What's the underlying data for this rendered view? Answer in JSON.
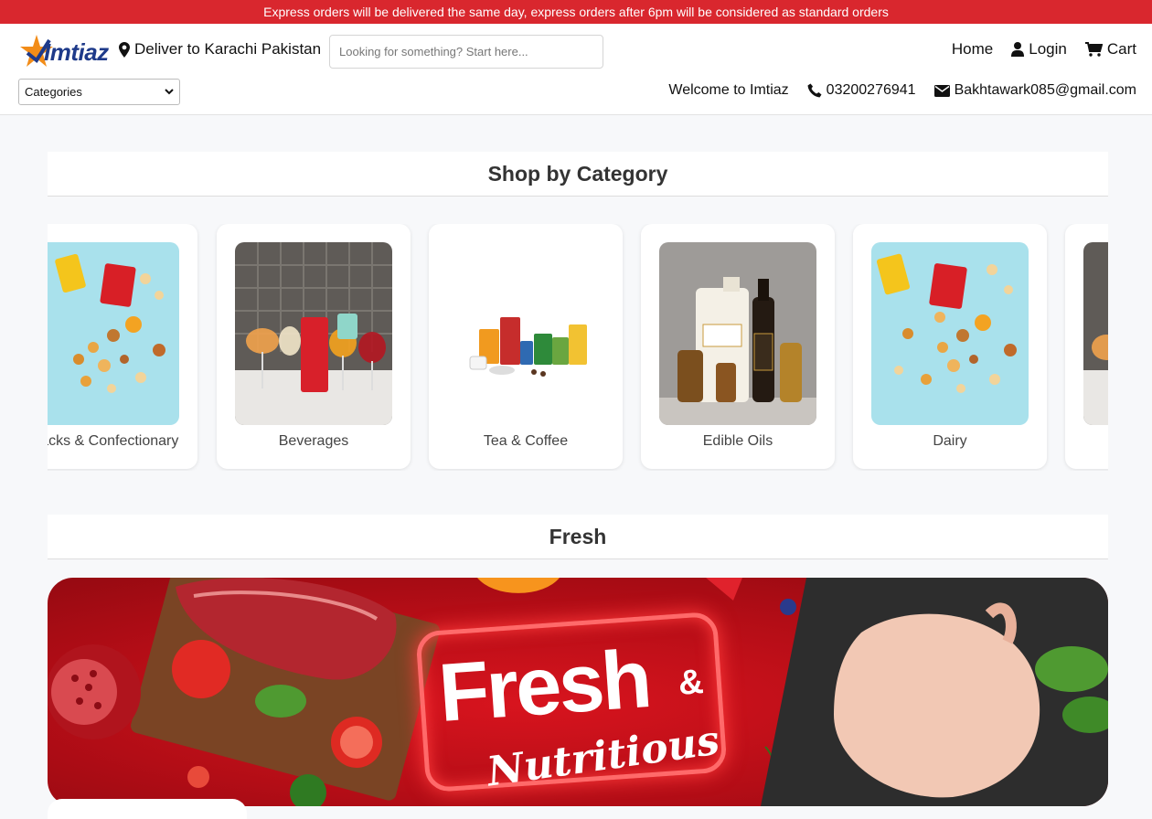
{
  "announcement": "Express orders will be delivered the same day, express orders after 6pm will be considered as standard orders",
  "brand": {
    "name": "Imtiaz"
  },
  "deliver": {
    "label": "Deliver to Karachi Pakistan"
  },
  "search": {
    "placeholder": "Looking for something? Start here..."
  },
  "nav": {
    "home": "Home",
    "login": "Login",
    "cart": "Cart"
  },
  "categories_select": {
    "selected": "Categories"
  },
  "contact": {
    "welcome": "Welcome to Imtiaz",
    "phone": "03200276941",
    "email": "Bakhtawark085@gmail.com"
  },
  "sections": {
    "shop_by_category": "Shop by Category",
    "fresh": "Fresh"
  },
  "category_cards": [
    {
      "label": "Snacks & Confectionary"
    },
    {
      "label": "Beverages"
    },
    {
      "label": "Tea & Coffee"
    },
    {
      "label": "Edible Oils"
    },
    {
      "label": "Dairy"
    }
  ],
  "banner": {
    "headline": "Fresh",
    "ampersand": "&",
    "subline": "Nutritious"
  },
  "colors": {
    "announcement_bg": "#d9272e",
    "brand_blue": "#1e3a8a",
    "brand_orange": "#f28c18",
    "banner_red": "#c0121b"
  },
  "icons": [
    "map-pin-icon",
    "user-icon",
    "cart-icon",
    "phone-icon",
    "envelope-icon",
    "chevron-down-icon"
  ]
}
